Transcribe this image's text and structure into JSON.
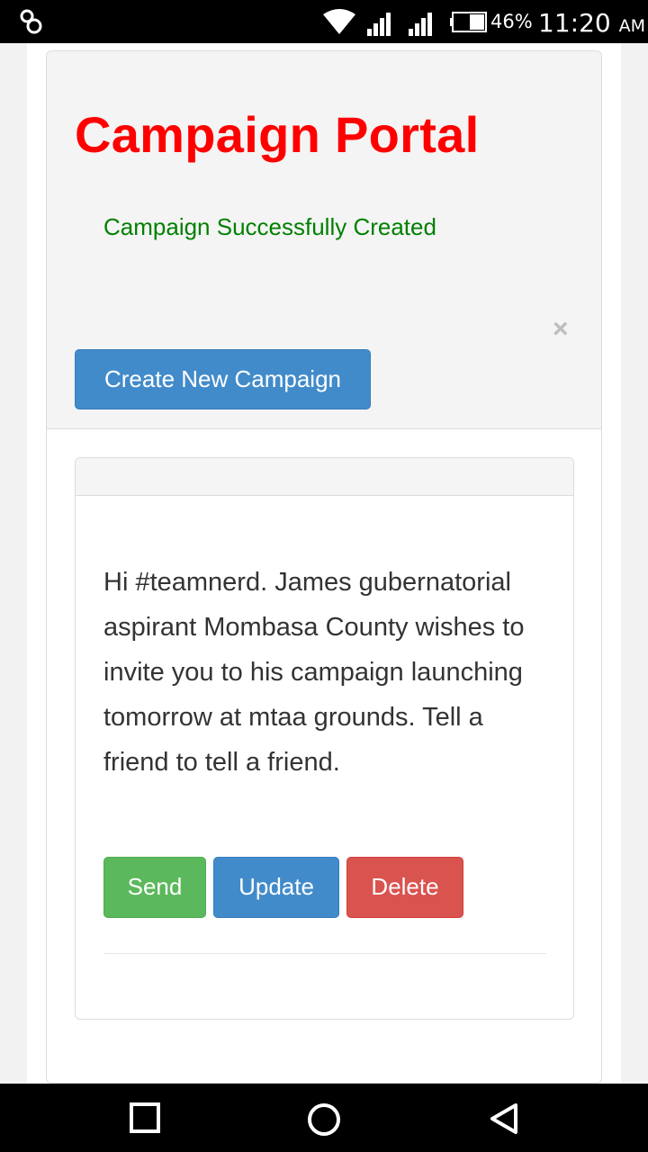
{
  "status_bar": {
    "app_icon": "infinity-app-icon",
    "battery_percent": "46%",
    "time": "11:20",
    "ampm": "AM"
  },
  "header": {
    "title": "Campaign Portal",
    "alert_message": "Campaign Successfully Created",
    "close_symbol": "×",
    "create_button_label": "Create New Campaign"
  },
  "campaign": {
    "message": "Hi #teamnerd. James gubernatorial aspirant Mombasa County wishes to invite you to his campaign launching tomorrow at mtaa grounds. Tell a friend to tell a friend.",
    "actions": {
      "send_label": "Send",
      "update_label": "Update",
      "delete_label": "Delete"
    }
  },
  "colors": {
    "title": "#ff0000",
    "alert": "#008000",
    "primary": "#428bca",
    "success": "#5cb85c",
    "danger": "#d9534f"
  },
  "nav_bar": {
    "icons": [
      "recents-square-icon",
      "home-circle-icon",
      "back-triangle-icon"
    ]
  }
}
